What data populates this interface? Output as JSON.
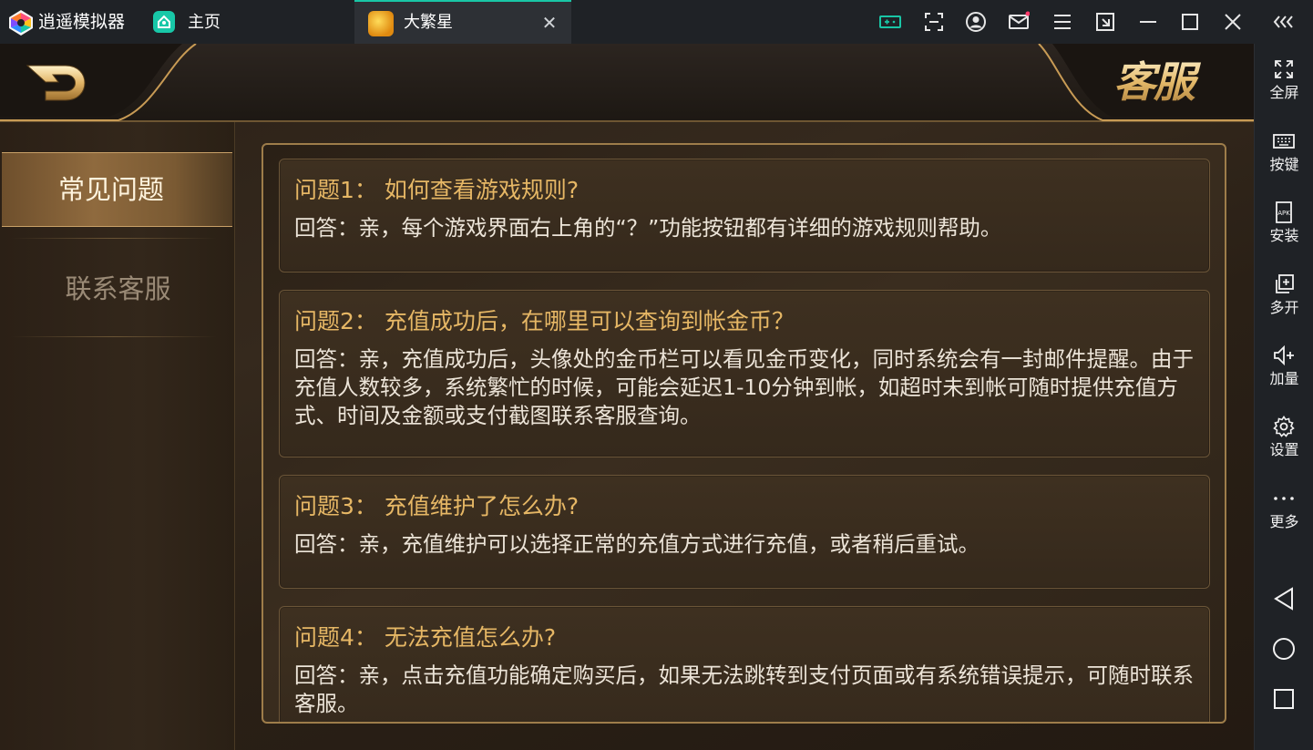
{
  "emulator": {
    "app_name": "逍遥模拟器",
    "home_tab_label": "主页",
    "active_tab_label": "大繁星",
    "accent_color": "#19c6a6"
  },
  "sidebar": {
    "items": [
      {
        "label": "全屏",
        "icon": "fullscreen-icon"
      },
      {
        "label": "按键",
        "icon": "keyboard-icon"
      },
      {
        "label": "安装",
        "icon": "apk-icon"
      },
      {
        "label": "多开",
        "icon": "multi-instance-icon"
      },
      {
        "label": "加量",
        "icon": "volume-up-icon"
      },
      {
        "label": "设置",
        "icon": "gear-icon"
      },
      {
        "label": "更多",
        "icon": "more-icon"
      }
    ]
  },
  "game": {
    "page_title": "客服",
    "menu": {
      "faq_label": "常见问题",
      "contact_label": "联系客服"
    },
    "faqs": [
      {
        "question": "问题1：  如何查看游戏规则?",
        "answer": "回答：亲，每个游戏界面右上角的“？”功能按钮都有详细的游戏规则帮助。"
      },
      {
        "question": "问题2：  充值成功后，在哪里可以查询到帐金币？",
        "answer": "回答：亲，充值成功后，头像处的金币栏可以看见金币变化，同时系统会有一封邮件提醒。由于充值人数较多，系统繁忙的时候，可能会延迟1-10分钟到帐，如超时未到帐可随时提供充值方式、时间及金额或支付截图联系客服查询。"
      },
      {
        "question": "问题3：  充值维护了怎么办?",
        "answer": "回答：亲，充值维护可以选择正常的充值方式进行充值，或者稍后重试。"
      },
      {
        "question": "问题4：  无法充值怎么办?",
        "answer": "回答：亲，点击充值功能确定购买后，如果无法跳转到支付页面或有系统错误提示，可随时联系客服。"
      }
    ]
  }
}
